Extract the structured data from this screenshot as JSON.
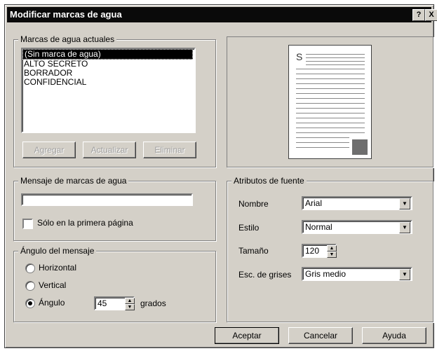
{
  "window": {
    "title": "Modificar marcas de agua",
    "help_glyph": "?",
    "close_glyph": "X"
  },
  "current": {
    "legend": "Marcas de agua actuales",
    "items": [
      "(Sin marca de agua)",
      "ALTO SECRETO",
      "BORRADOR",
      "CONFIDENCIAL"
    ],
    "selected_index": 0,
    "buttons": {
      "add": "Agregar",
      "update": "Actualizar",
      "delete": "Eliminar"
    }
  },
  "message": {
    "legend": "Mensaje de marcas de agua",
    "text_value": "",
    "first_page_label": "Sólo en la primera página",
    "first_page_checked": false
  },
  "angle": {
    "legend": "Ángulo del mensaje",
    "horizontal": "Horizontal",
    "vertical": "Vertical",
    "angle_label": "Ángulo",
    "selected": "angle",
    "value": "45",
    "unit": "grados"
  },
  "font": {
    "legend": "Atributos de fuente",
    "name_label": "Nombre",
    "name_value": "Arial",
    "style_label": "Estilo",
    "style_value": "Normal",
    "size_label": "Tamaño",
    "size_value": "120",
    "gray_label": "Esc. de grises",
    "gray_value": "Gris medio"
  },
  "preview": {
    "glyph": "S"
  },
  "footer": {
    "ok": "Aceptar",
    "cancel": "Cancelar",
    "help": "Ayuda"
  }
}
